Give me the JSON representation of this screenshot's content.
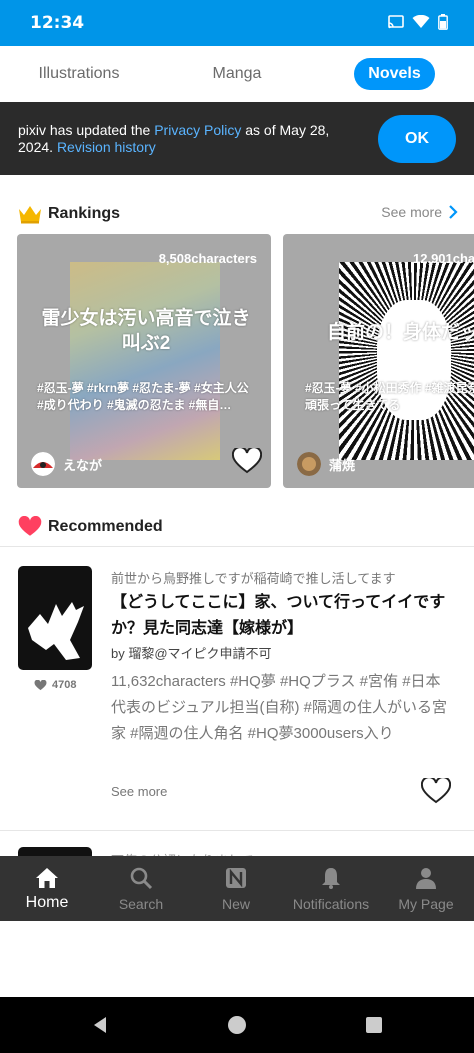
{
  "status_bar": {
    "time": "12:34"
  },
  "tabs": [
    {
      "label": "Illustrations"
    },
    {
      "label": "Manga"
    },
    {
      "label": "Novels"
    }
  ],
  "banner": {
    "text_pre": "pixiv has updated the ",
    "privacy_link": "Privacy Policy",
    "text_mid": " as of May 28, 2024. ",
    "revision_link": "Revision history",
    "ok_label": "OK"
  },
  "rankings": {
    "title": "Rankings",
    "see_more": "See more",
    "cards": [
      {
        "characters": "8,508characters",
        "title": "雷少女は汚い高音で泣き叫ぶ2",
        "tags": "#忍玉-夢 #rkrn夢 #忍たま-夢 #女主人公 #成り代わり #鬼滅の忍たま #無自…",
        "author": "えなが"
      },
      {
        "characters": "12,901cha",
        "title": "自前の！身体だッ",
        "tags": "#忍玉-夢 #小松田秀作 #雑渡昆奈門 #頑張って生きてる",
        "author": "蒲焼"
      }
    ]
  },
  "recommended": {
    "title": "Recommended",
    "item": {
      "series": "前世から烏野推しですが稲荷崎で推し活してます",
      "title": "【どうしてここに】家、ついて行ってイイですか？見た同志達【嫁様が】",
      "author": "by 瑠黎@マイピク申請不可",
      "tags": "11,632characters #HQ夢 #HQプラス #宮侑 #日本代表のビジュアル担当(自称) #隔週の住人がいる宮家 #隔週の住人角名 #HQ夢3000users入り",
      "likes": "4708",
      "see_more": "See more"
    },
    "next_item_series": "下俺の公認になりまして"
  },
  "bottom_nav": [
    {
      "label": "Home",
      "icon": "home-icon"
    },
    {
      "label": "Search",
      "icon": "search-icon"
    },
    {
      "label": "New",
      "icon": "new-icon"
    },
    {
      "label": "Notifications",
      "icon": "bell-icon"
    },
    {
      "label": "My Page",
      "icon": "person-icon"
    }
  ],
  "colors": {
    "accent": "#0096fa",
    "status_bar": "#0095e8",
    "banner_bg": "#2b2b2b",
    "nav_bg": "#333333"
  }
}
